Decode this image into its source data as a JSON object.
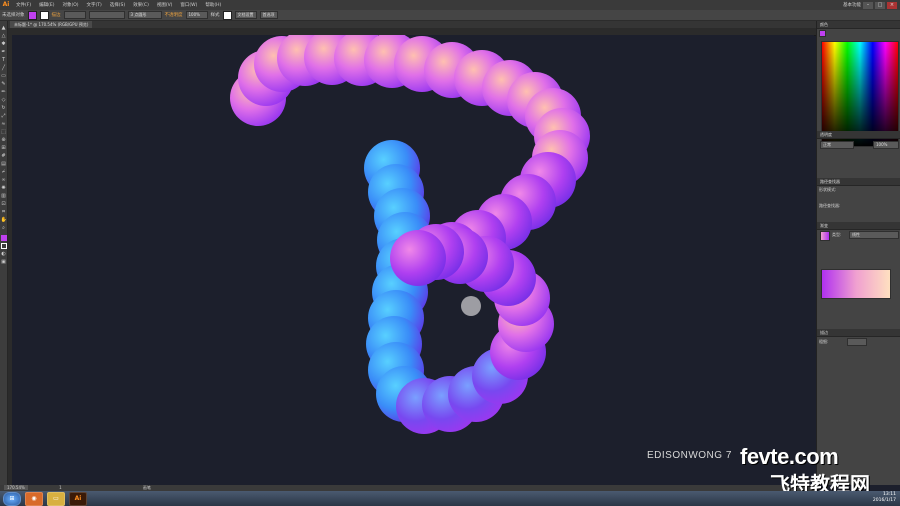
{
  "app": {
    "logo": "Ai"
  },
  "menu": {
    "items": [
      "文件(F)",
      "编辑(E)",
      "对象(O)",
      "文字(T)",
      "选择(S)",
      "效果(C)",
      "视图(V)",
      "窗口(W)",
      "帮助(H)"
    ],
    "workspace": "基本功能"
  },
  "control_bar": {
    "selection": "未选择对象",
    "stroke_label": "描边",
    "brush": "3 点圆形",
    "opacity_label": "不透明度",
    "opacity_value": "100%",
    "style_label": "样式",
    "doc_setup": "文档设置",
    "prefs": "首选项"
  },
  "document": {
    "tab_title": "未标题-1* @ 170.54% (RGB/GPU 预览)"
  },
  "panels": {
    "color_tab": "颜色",
    "transparency_tab": "透明度",
    "blend_mode": "正常",
    "opacity_value": "100%",
    "pathfinder_tab": "路径查找器",
    "shape_modes": "形状模式:",
    "pathfinders": "路径查找器:",
    "gradient_tab": "渐变",
    "gradient_type_label": "类型:",
    "gradient_type": "线性",
    "stroke_tab": "描边",
    "weight_label": "粗细:"
  },
  "status": {
    "zoom": "170.54%",
    "page": "1",
    "tool": "画笔"
  },
  "watermark": {
    "author": "EDISONWONG 7",
    "site_latin": "fevte.com",
    "site_cn": "飞特教程网"
  },
  "taskbar": {
    "time": "13:11",
    "date": "2016/1/17"
  },
  "colors": {
    "gradient_pink": "#f0a0d0",
    "gradient_purple": "#b030f0",
    "gradient_blue": "#30a8f8",
    "canvas": "#1c1f2c"
  },
  "icons": [
    "selection-tool-icon",
    "direct-selection-icon",
    "pen-icon",
    "type-icon",
    "line-icon",
    "rectangle-icon",
    "brush-icon",
    "pencil-icon",
    "rotate-icon",
    "scale-icon",
    "gradient-icon",
    "eyedropper-icon",
    "hand-icon",
    "zoom-icon"
  ]
}
